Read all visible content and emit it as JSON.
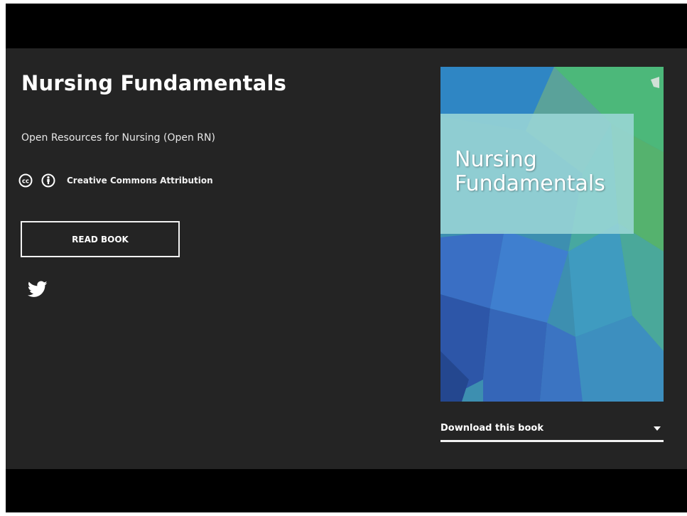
{
  "book": {
    "title": "Nursing Fundamentals",
    "publisher": "Open Resources for Nursing (Open RN)",
    "license_label": "Creative Commons Attribution",
    "read_button_label": "READ BOOK",
    "cover_title": "Nursing\nFundamentals",
    "download_label": "Download this book"
  },
  "icons": {
    "license_cc": "creative-commons-icon",
    "license_by": "attribution-icon",
    "share": "twitter-icon",
    "download_toggle": "caret-down-icon"
  },
  "colors": {
    "panel_bg": "#242424",
    "letterbox": "#000000",
    "text": "#ffffff",
    "cover_overlay": "#9bd6d6"
  }
}
